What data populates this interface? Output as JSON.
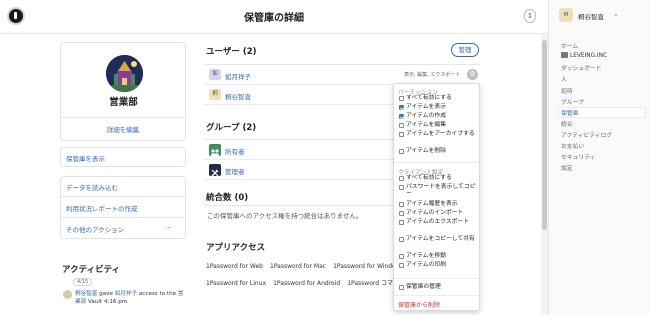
{
  "header": {
    "title": "保管庫の詳細",
    "refresh_icon": "sync-icon"
  },
  "vault": {
    "name": "営業部",
    "edit_details": "詳細を編集",
    "show_vault": "保管庫を表示",
    "import_data": "データを読み込む",
    "usage_report": "利用状況レポートの作成",
    "other_actions": "その他のアクション",
    "more_dots": "···"
  },
  "activity": {
    "title": "アクティビティ",
    "time_badge": "4/15",
    "actor": "桐谷智直",
    "verb": "gave",
    "target": "如月祥子",
    "rest": "access to the",
    "vault_link": "営業部",
    "vault_suffix": "Vault",
    "time": "4:16 pm"
  },
  "users": {
    "heading": "ユーザー",
    "count": "(2)",
    "manage": "管理",
    "rows": [
      {
        "initials": "如",
        "name": "如月祥子",
        "perms": "表示, 編集, エクスポート"
      },
      {
        "initials": "桐",
        "name": "桐谷智直",
        "perms": ""
      }
    ]
  },
  "groups": {
    "heading": "グループ",
    "count": "(2)",
    "rows": [
      {
        "name": "所有者"
      },
      {
        "name": "管理者"
      }
    ]
  },
  "integrations": {
    "heading": "統合数",
    "count": "(0)",
    "empty": "この保管庫へのアクセス権を持つ統合はありません。"
  },
  "apps": {
    "heading": "アプリアクセス",
    "row1": [
      "1Password for Web",
      "1Password for Mac",
      "1Password for Windows"
    ],
    "row2": [
      "1Password for Linux",
      "1Password for Android",
      "1Password コマンド"
    ]
  },
  "permissions_popup": {
    "section1": "パーミッション",
    "all1": "すべて有効にする",
    "items1": [
      {
        "label": "アイテムを表示",
        "checked": true
      },
      {
        "label": "アイテムの作成",
        "checked": true
      },
      {
        "label": "アイテムを編集",
        "checked": false
      },
      {
        "label": "アイテムをアーカイブする",
        "checked": false
      },
      {
        "label": "アイテムを削除",
        "checked": false
      }
    ],
    "section2": "クライアント設定",
    "all2": "すべて有効にする",
    "items2": [
      {
        "label": "パスワードを表示してコピー",
        "checked": false
      },
      {
        "label": "アイテム履歴を表示",
        "checked": false
      },
      {
        "label": "アイテムのインポート",
        "checked": false
      },
      {
        "label": "アイテムのエクスポート",
        "checked": false
      },
      {
        "label": "アイテムをコピーして共有",
        "checked": false
      },
      {
        "label": "アイテムを移動",
        "checked": false
      },
      {
        "label": "アイテムの印刷",
        "checked": false
      }
    ],
    "manage_vault": "保管庫の管理",
    "remove": "保管庫から削除"
  },
  "account": {
    "initials": "M",
    "name": "桐谷智直",
    "chevron": "⌄"
  },
  "nav": {
    "home": "ホーム",
    "org": "LEVEING.INC",
    "dashboard": "ダッシュボード",
    "people": "人",
    "invite": "招待",
    "groups": "グループ",
    "vaults": "保管庫",
    "integrations": "統合",
    "activity_log": "アクティビティログ",
    "billing": "お支払い",
    "security": "セキュリティ",
    "settings": "設定"
  },
  "colors": {
    "accent": "#3369c6",
    "danger": "#d0342c"
  }
}
